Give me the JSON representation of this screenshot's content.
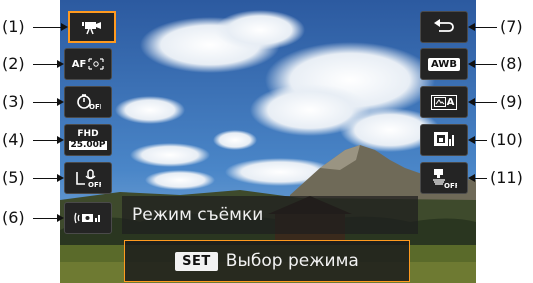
{
  "callouts": {
    "c1": "(1)",
    "c2": "(2)",
    "c3": "(3)",
    "c4": "(4)",
    "c5": "(5)",
    "c6": "(6)",
    "c7": "(7)",
    "c8": "(8)",
    "c9": "(9)",
    "c10": "(10)",
    "c11": "(11)"
  },
  "quick_control": {
    "left_icons": [
      {
        "icon": "movie-mode-icon"
      },
      {
        "icon": "af-method-icon",
        "text": "AF"
      },
      {
        "icon": "self-timer-off-icon"
      },
      {
        "icon": "movie-rec-size-icon",
        "line1": "FHD",
        "line2": "25.00P"
      },
      {
        "icon": "sound-recording-off-icon"
      },
      {
        "icon": "image-stabilizer-icon"
      }
    ],
    "right_icons": [
      {
        "icon": "back-arrow-icon"
      },
      {
        "icon": "white-balance-icon",
        "text": "AWB"
      },
      {
        "icon": "picture-style-icon",
        "text": "A"
      },
      {
        "icon": "creative-filter-icon"
      },
      {
        "icon": "time-lapse-off-icon"
      }
    ],
    "selected_index": 0
  },
  "screen": {
    "mode_label": "Режим съёмки",
    "set_key": "SET",
    "hint": "Выбор режима"
  },
  "colors": {
    "accent": "#ff9a1f",
    "button_bg": "#242424"
  }
}
